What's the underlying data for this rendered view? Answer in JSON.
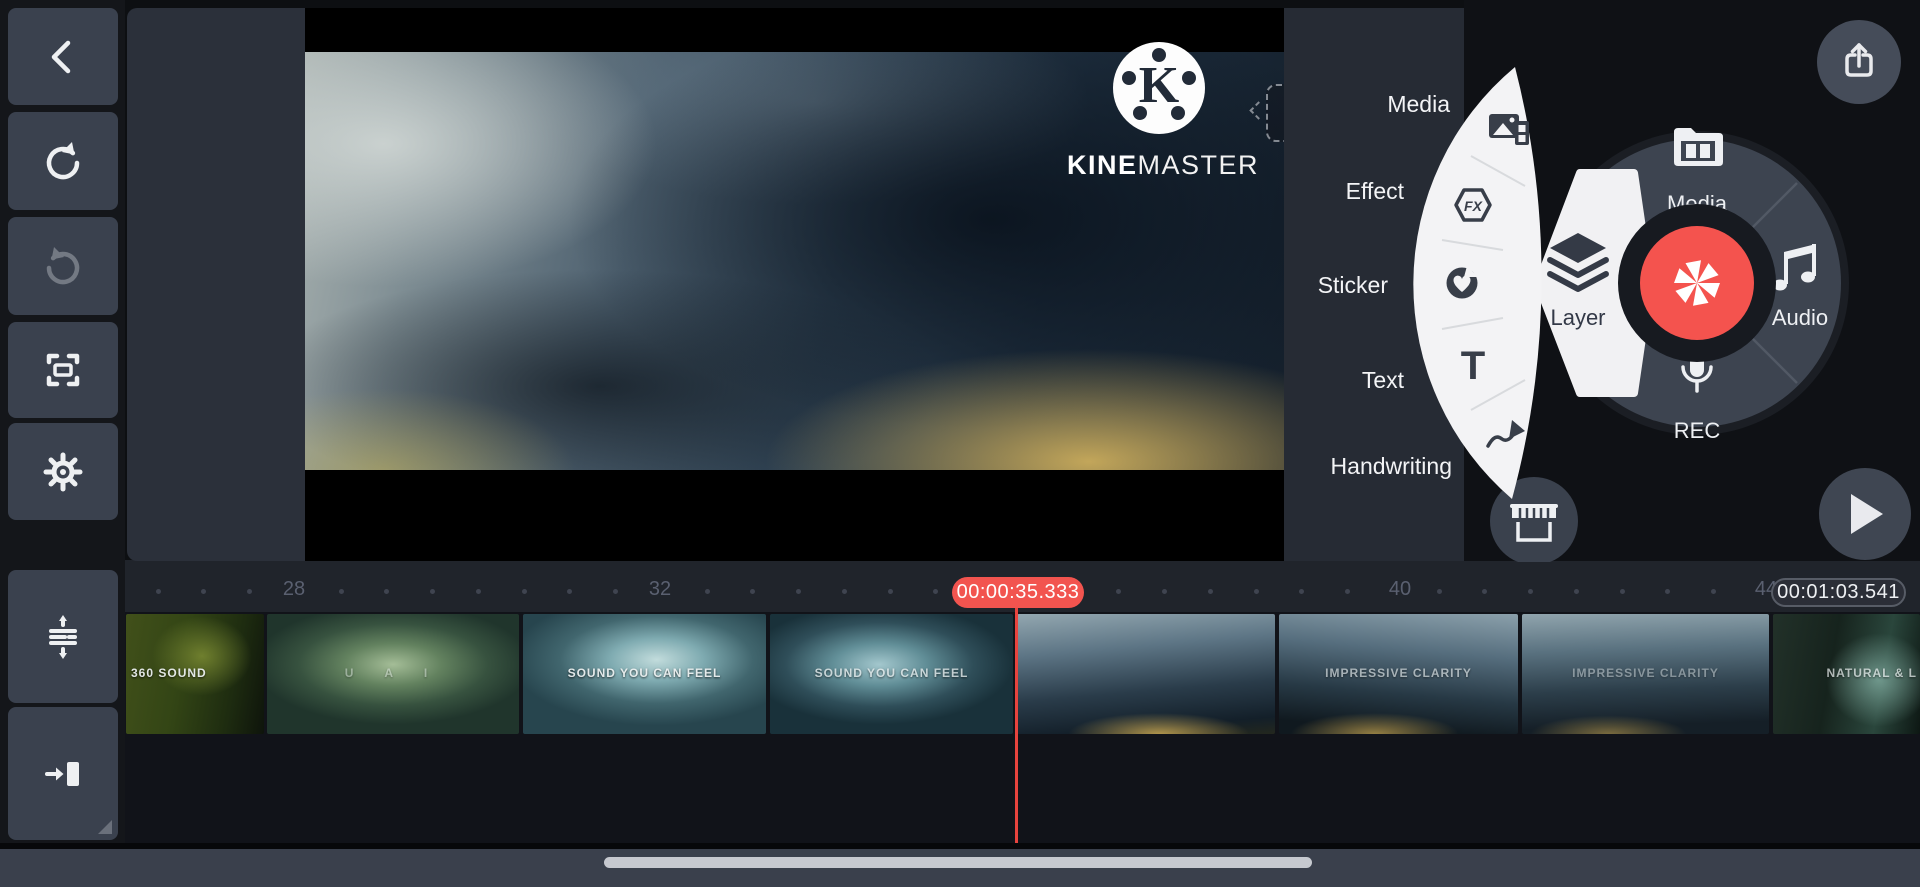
{
  "app": {
    "name": "KineMaster"
  },
  "colors": {
    "accent_red": "#F4534E",
    "wheel": "#3D4450",
    "panel": "#262B34",
    "sidebar_button": "#3A414E",
    "footer": "#3A404C"
  },
  "sidebar": {
    "buttons": [
      {
        "id": "back",
        "icon": "back-chevron-icon"
      },
      {
        "id": "undo",
        "icon": "undo-icon"
      },
      {
        "id": "redo",
        "icon": "redo-icon"
      },
      {
        "id": "capture",
        "icon": "capture-frame-icon"
      },
      {
        "id": "settings",
        "icon": "settings-gear-icon"
      },
      {
        "id": "timeline-expand",
        "icon": "timeline-expand-icon"
      },
      {
        "id": "jump-to-end",
        "icon": "jump-to-end-icon"
      }
    ]
  },
  "preview": {
    "watermark": {
      "monogram": "K",
      "brand_primary": "KINE",
      "brand_secondary": "MASTER"
    },
    "drop_target": {
      "icon": "trash-icon"
    }
  },
  "layer_menu": {
    "items": [
      {
        "label": "Media",
        "icon": "media-image-icon"
      },
      {
        "label": "Effect",
        "icon": "fx-effect-icon",
        "glyph": "FX"
      },
      {
        "label": "Sticker",
        "icon": "sticker-icon"
      },
      {
        "label": "Text",
        "icon": "text-icon",
        "glyph": "T"
      },
      {
        "label": "Handwriting",
        "icon": "handwriting-pen-icon"
      }
    ]
  },
  "wheel": {
    "top": {
      "label": "Media",
      "icon": "media-folder-icon"
    },
    "right": {
      "label": "Audio",
      "icon": "audio-note-icon"
    },
    "bottom": {
      "label": "REC",
      "icon": "mic-icon"
    },
    "left": {
      "label": "Layer",
      "icon": "layers-icon"
    },
    "center": {
      "icon": "capture-shutter-icon"
    },
    "store": {
      "icon": "asset-store-icon"
    }
  },
  "header": {
    "export_icon": "share-export-icon"
  },
  "transport": {
    "play_icon": "play-icon"
  },
  "timeline": {
    "ruler_numbers": [
      {
        "label": "28"
      },
      {
        "label": "32"
      },
      {
        "label": "40"
      },
      {
        "label": "44"
      }
    ],
    "playhead_time": "00:00:35.333",
    "total_duration": "00:01:03.541",
    "clips": [
      {
        "label": "360 SOUND"
      },
      {
        "label": "U A I"
      },
      {
        "label": "SOUND YOU CAN FEEL"
      },
      {
        "label": "SOUND YOU CAN FEEL"
      },
      {
        "label": ""
      },
      {
        "label": "IMPRESSIVE CLARITY"
      },
      {
        "label": "IMPRESSIVE CLARITY"
      },
      {
        "label": "NATURAL & L"
      }
    ]
  }
}
